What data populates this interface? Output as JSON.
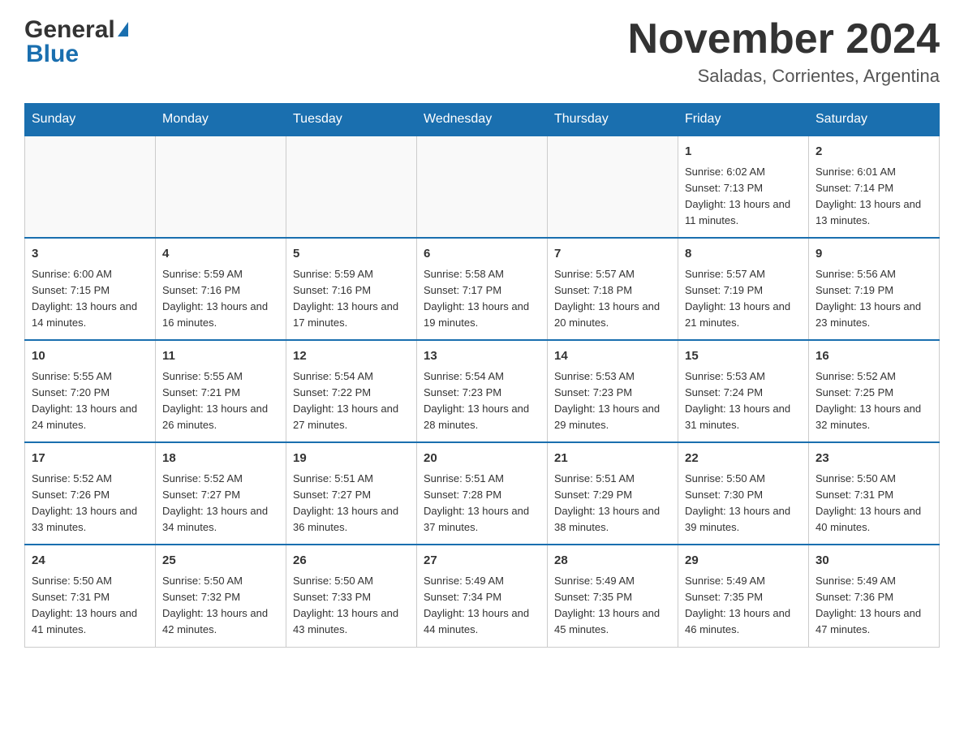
{
  "header": {
    "logo_general": "General",
    "logo_blue": "Blue",
    "month_title": "November 2024",
    "location": "Saladas, Corrientes, Argentina"
  },
  "days_of_week": [
    "Sunday",
    "Monday",
    "Tuesday",
    "Wednesday",
    "Thursday",
    "Friday",
    "Saturday"
  ],
  "weeks": [
    [
      {
        "day": "",
        "info": ""
      },
      {
        "day": "",
        "info": ""
      },
      {
        "day": "",
        "info": ""
      },
      {
        "day": "",
        "info": ""
      },
      {
        "day": "",
        "info": ""
      },
      {
        "day": "1",
        "info": "Sunrise: 6:02 AM\nSunset: 7:13 PM\nDaylight: 13 hours and 11 minutes."
      },
      {
        "day": "2",
        "info": "Sunrise: 6:01 AM\nSunset: 7:14 PM\nDaylight: 13 hours and 13 minutes."
      }
    ],
    [
      {
        "day": "3",
        "info": "Sunrise: 6:00 AM\nSunset: 7:15 PM\nDaylight: 13 hours and 14 minutes."
      },
      {
        "day": "4",
        "info": "Sunrise: 5:59 AM\nSunset: 7:16 PM\nDaylight: 13 hours and 16 minutes."
      },
      {
        "day": "5",
        "info": "Sunrise: 5:59 AM\nSunset: 7:16 PM\nDaylight: 13 hours and 17 minutes."
      },
      {
        "day": "6",
        "info": "Sunrise: 5:58 AM\nSunset: 7:17 PM\nDaylight: 13 hours and 19 minutes."
      },
      {
        "day": "7",
        "info": "Sunrise: 5:57 AM\nSunset: 7:18 PM\nDaylight: 13 hours and 20 minutes."
      },
      {
        "day": "8",
        "info": "Sunrise: 5:57 AM\nSunset: 7:19 PM\nDaylight: 13 hours and 21 minutes."
      },
      {
        "day": "9",
        "info": "Sunrise: 5:56 AM\nSunset: 7:19 PM\nDaylight: 13 hours and 23 minutes."
      }
    ],
    [
      {
        "day": "10",
        "info": "Sunrise: 5:55 AM\nSunset: 7:20 PM\nDaylight: 13 hours and 24 minutes."
      },
      {
        "day": "11",
        "info": "Sunrise: 5:55 AM\nSunset: 7:21 PM\nDaylight: 13 hours and 26 minutes."
      },
      {
        "day": "12",
        "info": "Sunrise: 5:54 AM\nSunset: 7:22 PM\nDaylight: 13 hours and 27 minutes."
      },
      {
        "day": "13",
        "info": "Sunrise: 5:54 AM\nSunset: 7:23 PM\nDaylight: 13 hours and 28 minutes."
      },
      {
        "day": "14",
        "info": "Sunrise: 5:53 AM\nSunset: 7:23 PM\nDaylight: 13 hours and 29 minutes."
      },
      {
        "day": "15",
        "info": "Sunrise: 5:53 AM\nSunset: 7:24 PM\nDaylight: 13 hours and 31 minutes."
      },
      {
        "day": "16",
        "info": "Sunrise: 5:52 AM\nSunset: 7:25 PM\nDaylight: 13 hours and 32 minutes."
      }
    ],
    [
      {
        "day": "17",
        "info": "Sunrise: 5:52 AM\nSunset: 7:26 PM\nDaylight: 13 hours and 33 minutes."
      },
      {
        "day": "18",
        "info": "Sunrise: 5:52 AM\nSunset: 7:27 PM\nDaylight: 13 hours and 34 minutes."
      },
      {
        "day": "19",
        "info": "Sunrise: 5:51 AM\nSunset: 7:27 PM\nDaylight: 13 hours and 36 minutes."
      },
      {
        "day": "20",
        "info": "Sunrise: 5:51 AM\nSunset: 7:28 PM\nDaylight: 13 hours and 37 minutes."
      },
      {
        "day": "21",
        "info": "Sunrise: 5:51 AM\nSunset: 7:29 PM\nDaylight: 13 hours and 38 minutes."
      },
      {
        "day": "22",
        "info": "Sunrise: 5:50 AM\nSunset: 7:30 PM\nDaylight: 13 hours and 39 minutes."
      },
      {
        "day": "23",
        "info": "Sunrise: 5:50 AM\nSunset: 7:31 PM\nDaylight: 13 hours and 40 minutes."
      }
    ],
    [
      {
        "day": "24",
        "info": "Sunrise: 5:50 AM\nSunset: 7:31 PM\nDaylight: 13 hours and 41 minutes."
      },
      {
        "day": "25",
        "info": "Sunrise: 5:50 AM\nSunset: 7:32 PM\nDaylight: 13 hours and 42 minutes."
      },
      {
        "day": "26",
        "info": "Sunrise: 5:50 AM\nSunset: 7:33 PM\nDaylight: 13 hours and 43 minutes."
      },
      {
        "day": "27",
        "info": "Sunrise: 5:49 AM\nSunset: 7:34 PM\nDaylight: 13 hours and 44 minutes."
      },
      {
        "day": "28",
        "info": "Sunrise: 5:49 AM\nSunset: 7:35 PM\nDaylight: 13 hours and 45 minutes."
      },
      {
        "day": "29",
        "info": "Sunrise: 5:49 AM\nSunset: 7:35 PM\nDaylight: 13 hours and 46 minutes."
      },
      {
        "day": "30",
        "info": "Sunrise: 5:49 AM\nSunset: 7:36 PM\nDaylight: 13 hours and 47 minutes."
      }
    ]
  ]
}
